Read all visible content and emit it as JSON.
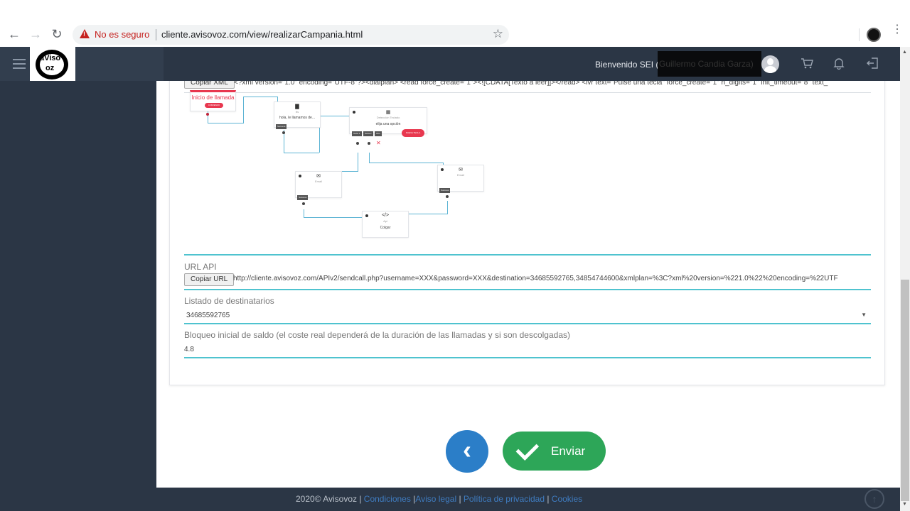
{
  "browser": {
    "back_icon": "←",
    "forward_icon": "→",
    "reload_icon": "↻",
    "security_label": "No es seguro",
    "url": "cliente.avisovoz.com/view/realizarCampania.html",
    "star_icon": "☆",
    "menu_icon": "⋮"
  },
  "header": {
    "logo_line1": "aViso",
    "logo_line2": "oz",
    "welcome": "Bienvenido SEI (",
    "username_redacted": "Guillermo Candia Garza)",
    "cart_icon": "🛒",
    "bell_icon": "🔔",
    "logout_icon": "⇤"
  },
  "xml": {
    "copy_label": "Copiar XML",
    "content": "<?xml version=\"1.0\" encoding=\"UTF-8\"?><dialplan> <read force_create=\"1\"><![CDATA[Texto a leer]]></read> <ivr text=\"Pulse una tecla\" force_create=\"1\" n_digits=\"1\" init_timeout=\"8\" text_"
  },
  "diagram": {
    "start": {
      "title": "Inicio de llamada",
      "badge": "COMIENZO"
    },
    "tts": {
      "icon": "▇",
      "sub": "tts",
      "text": "hola, le llamamos de...",
      "tag": "Success"
    },
    "ivr": {
      "icon": "▦",
      "sub": "Detección Teclado",
      "text": "elija una opción",
      "tags": [
        "Tecla 1",
        "Tecla 2",
        "Otro"
      ],
      "add_button": "NUEVA TECLA"
    },
    "email1": {
      "icon": "✉",
      "sub": "Email",
      "tag": "Success"
    },
    "email2": {
      "icon": "✉",
      "sub": "Email",
      "tag": "Success"
    },
    "api": {
      "icon": "</>",
      "sub": "Api",
      "text": "Colgar"
    }
  },
  "url_api": {
    "label": "URL API",
    "copy_label": "Copiar URL",
    "value": "http://cliente.avisovoz.com/APIv2/sendcall.php?username=XXX&password=XXX&destination=34685592765,34854744600&xmlplan=%3C?xml%20version=%221.0%22%20encoding=%22UTF"
  },
  "recipients": {
    "label": "Listado de destinatarios",
    "value": "34685592765",
    "caret": "▼"
  },
  "balance": {
    "label": "Bloqueo inicial de saldo (el coste real dependerá de la duración de las llamadas y si son descolgadas)",
    "value": "4.8"
  },
  "actions": {
    "back_icon": "‹",
    "send_label": "Enviar"
  },
  "footer": {
    "copyright": "2020©  Avisovoz | ",
    "links": [
      "Condiciones",
      "Aviso legal",
      "Política de privacidad",
      "Cookies"
    ],
    "scroll_top_icon": "↑"
  },
  "colors": {
    "accent_teal": "#4fc3cf",
    "send_green": "#2da658",
    "back_blue": "#2b7ec8",
    "header_dark": "#2b3645",
    "start_red": "#e8384f"
  }
}
